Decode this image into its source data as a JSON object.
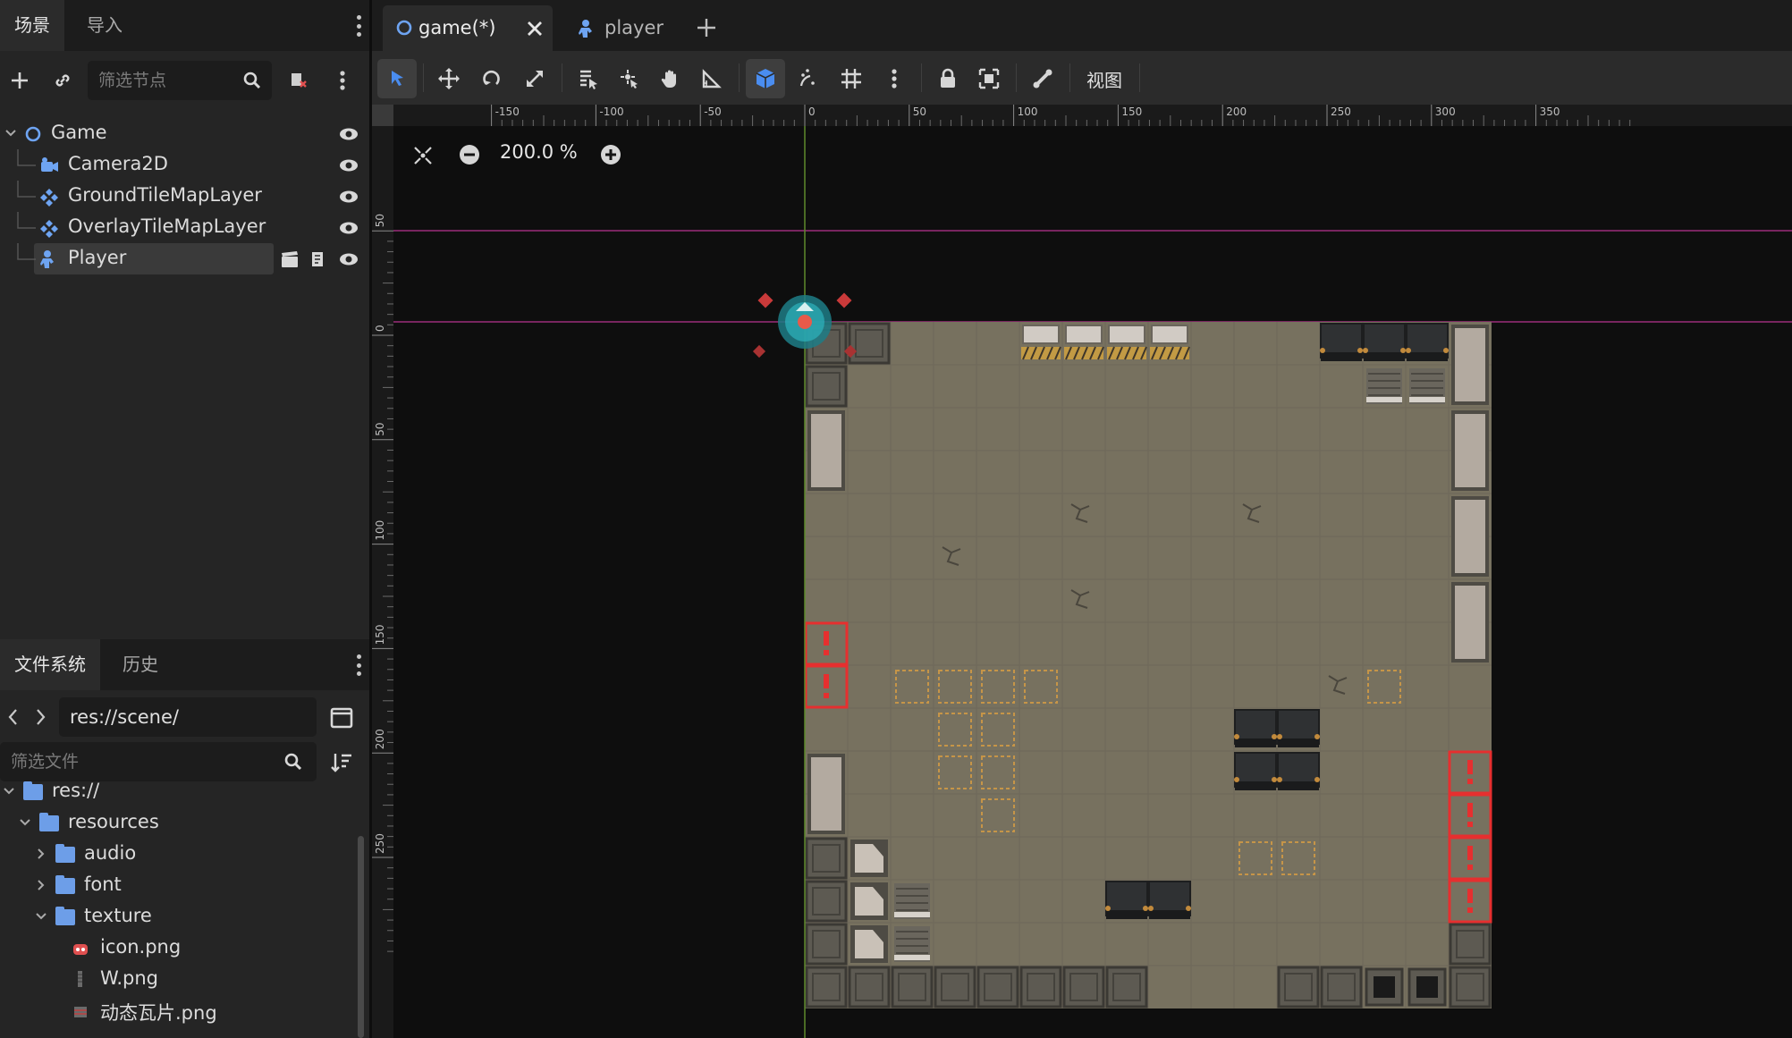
{
  "scene_dock": {
    "tabs": [
      "场景",
      "导入"
    ],
    "filter_placeholder": "筛选节点",
    "nodes": [
      {
        "name": "Game",
        "icon": "node2d-icon"
      },
      {
        "name": "Camera2D",
        "icon": "camera2d-icon"
      },
      {
        "name": "GroundTileMapLayer",
        "icon": "tilemaplayer-icon"
      },
      {
        "name": "OverlayTileMapLayer",
        "icon": "tilemaplayer-icon"
      },
      {
        "name": "Player",
        "icon": "character-icon"
      }
    ],
    "selected_node": "Player"
  },
  "filesystem_dock": {
    "tabs": [
      "文件系统",
      "历史"
    ],
    "path": "res://scene/",
    "filter_placeholder": "筛选文件",
    "items": [
      {
        "name": "res://",
        "type": "folder"
      },
      {
        "name": "resources",
        "type": "folder"
      },
      {
        "name": "audio",
        "type": "folder"
      },
      {
        "name": "font",
        "type": "folder"
      },
      {
        "name": "texture",
        "type": "folder"
      },
      {
        "name": "icon.png",
        "type": "image"
      },
      {
        "name": "W.png",
        "type": "image"
      },
      {
        "name": "动态瓦片.png",
        "type": "image"
      }
    ]
  },
  "scene_tabs": [
    {
      "label": "game(*)",
      "icon": "node2d-icon",
      "active": true
    },
    {
      "label": "player",
      "icon": "character-icon",
      "active": false
    }
  ],
  "toolbar": {
    "view_menu": "视图",
    "active_tool": "select-tool",
    "tools": [
      "select-tool",
      "move-tool",
      "rotate-tool",
      "scale-tool",
      "list-select-tool",
      "pivot-tool",
      "pan-tool",
      "ruler-tool",
      "smart-snap-toggle",
      "grid-snap-toggle",
      "snap-options",
      "more-options",
      "lock-icon",
      "group-icon",
      "skeleton-icon"
    ]
  },
  "viewport": {
    "zoom": "200.0 %",
    "ruler_h_labels": [
      "-150",
      "-100",
      "-50",
      "0",
      "50",
      "100",
      "150",
      "200",
      "250",
      "300",
      "350"
    ],
    "ruler_v_labels": [
      "50",
      "0",
      "50",
      "100",
      "150",
      "200",
      "250"
    ],
    "colors": {
      "accent": "#4a8df0",
      "floor": "#77715f",
      "guide_magenta": "#9b2d7a",
      "axis_green": "#5f8a2b",
      "warning_red": "#e62f2f"
    }
  }
}
